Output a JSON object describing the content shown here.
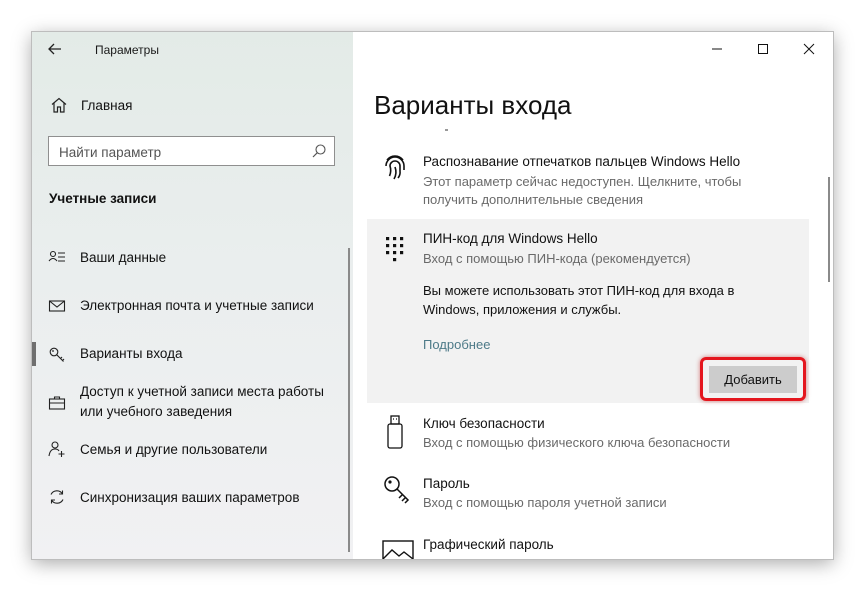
{
  "window": {
    "app_title": "Параметры",
    "back_label": "←"
  },
  "sidebar": {
    "home_label": "Главная",
    "search_placeholder": "Найти параметр",
    "section_title": "Учетные записи",
    "items": [
      {
        "label": "Ваши данные",
        "icon": "user-lines-icon"
      },
      {
        "label": "Электронная почта и учетные записи",
        "icon": "mail-icon"
      },
      {
        "label": "Варианты входа",
        "icon": "key-icon",
        "active": true
      },
      {
        "label": "Доступ к учетной записи места работы или учебного заведения",
        "icon": "briefcase-icon"
      },
      {
        "label": "Семья и другие пользователи",
        "icon": "person-add-icon"
      },
      {
        "label": "Синхронизация ваших параметров",
        "icon": "sync-icon"
      }
    ]
  },
  "main": {
    "title": "Варианты входа",
    "options": [
      {
        "title": "Распознавание отпечатков пальцев Windows Hello",
        "desc": "Этот параметр сейчас недоступен. Щелкните, чтобы получить дополнительные сведения",
        "icon": "fingerprint-icon"
      },
      {
        "title": "ПИН-код для Windows Hello",
        "desc": "Вход с помощью ПИН-кода (рекомендуется)",
        "text": "Вы можете использовать этот ПИН-код для входа в Windows, приложения и службы.",
        "link": "Подробнее",
        "button": "Добавить",
        "icon": "keypad-icon"
      },
      {
        "title": "Ключ безопасности",
        "desc": "Вход с помощью физического ключа безопасности",
        "icon": "usb-key-icon"
      },
      {
        "title": "Пароль",
        "desc": "Вход с помощью пароля учетной записи",
        "icon": "password-key-icon"
      },
      {
        "title": "Графический пароль",
        "desc": "",
        "icon": "picture-icon"
      }
    ]
  },
  "colors": {
    "highlight": "#e4161e",
    "link": "#4d7a88",
    "button_bg": "#cccccc"
  }
}
